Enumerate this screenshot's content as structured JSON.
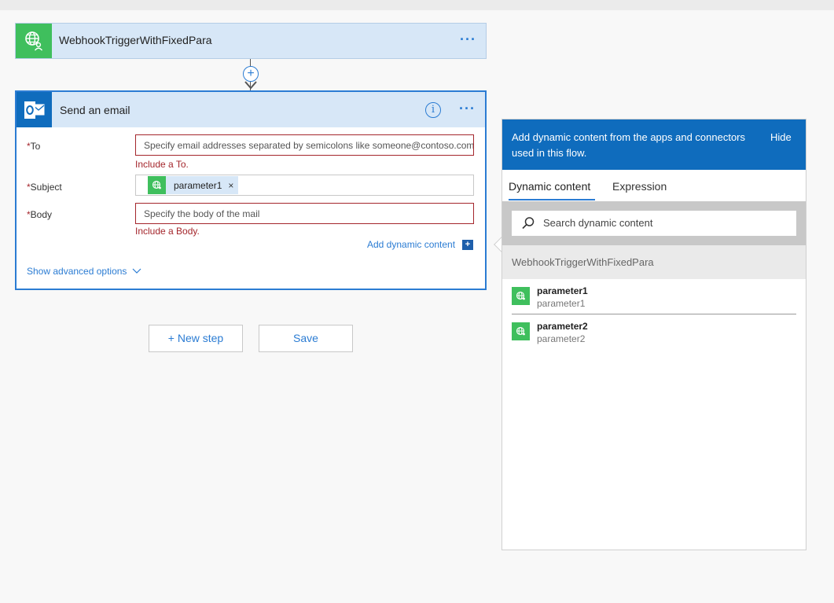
{
  "trigger": {
    "title": "WebhookTriggerWithFixedPara",
    "icon": "globe-person-icon",
    "more": "···"
  },
  "connector": {
    "add": "+"
  },
  "action": {
    "title": "Send an email",
    "info": "i",
    "more": "···",
    "fields": {
      "to": {
        "label": "To",
        "required_mark": "*",
        "placeholder": "Specify email addresses separated by semicolons like someone@contoso.com",
        "error": "Include a To."
      },
      "subject": {
        "label": "Subject",
        "required_mark": "*",
        "token": "parameter1",
        "token_remove": "×"
      },
      "body": {
        "label": "Body",
        "required_mark": "*",
        "placeholder": "Specify the body of the mail",
        "error": "Include a Body."
      }
    },
    "add_dynamic_content": "Add dynamic content",
    "add_dynamic_icon": "+",
    "show_advanced": "Show advanced options"
  },
  "buttons": {
    "new_step": "+ New step",
    "save": "Save"
  },
  "dynamic_panel": {
    "header": "Add dynamic content from the apps and connectors used in this flow.",
    "hide": "Hide",
    "tabs": [
      "Dynamic content",
      "Expression"
    ],
    "search_placeholder": "Search dynamic content",
    "group": "WebhookTriggerWithFixedPara",
    "items": [
      {
        "name": "parameter1",
        "description": "parameter1"
      },
      {
        "name": "parameter2",
        "description": "parameter2"
      }
    ]
  },
  "colors": {
    "accent": "#2b7cd3",
    "trigger_green": "#3fbf5d",
    "outlook_blue": "#0f6cbd",
    "error_red": "#a4262c",
    "header_tint": "#d7e7f7"
  }
}
